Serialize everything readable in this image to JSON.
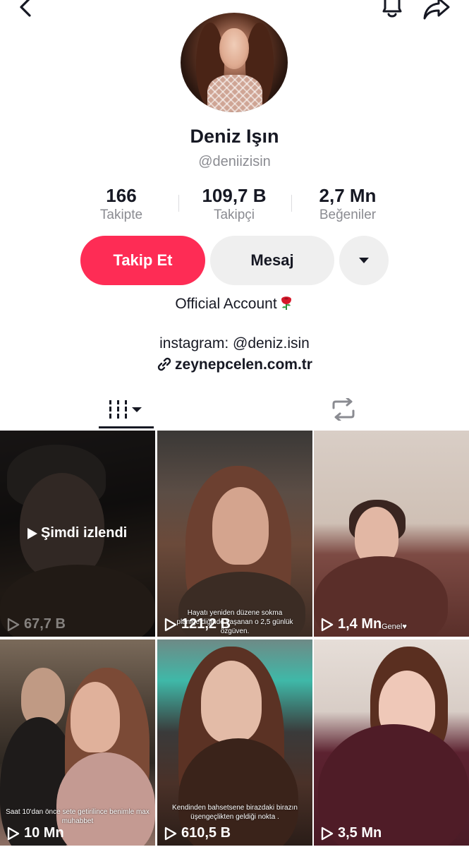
{
  "header": {
    "back_icon": "chevron-left-icon",
    "bell_icon": "bell-icon",
    "share_icon": "share-arrow-icon"
  },
  "profile": {
    "name": "Deniz Işın",
    "handle": "@deniizisin",
    "stats": [
      {
        "value": "166",
        "label": "Takipte"
      },
      {
        "value": "109,7 B",
        "label": "Takipçi"
      },
      {
        "value": "2,7 Mn",
        "label": "Beğeniler"
      }
    ],
    "follow_label": "Takip Et",
    "message_label": "Mesaj",
    "bio": "Official Account",
    "instagram": "instagram: @deniz.isin",
    "website": "zeynepcelen.com.tr"
  },
  "tabs": {
    "videos_icon": "grid-bars-icon",
    "repost_icon": "repost-icon"
  },
  "videos": [
    {
      "views": "67,7 B",
      "overlay": "Şimdi izlendi",
      "caption": ""
    },
    {
      "views": "121,2 B",
      "overlay": "",
      "caption": "Hayatı yeniden düzene sokma planıgeldiğinde yaşanan o 2,5 günlük özgüven."
    },
    {
      "views": "1,4 Mn",
      "overlay": "",
      "caption": "Genel♥"
    },
    {
      "views": "10 Mn",
      "overlay": "",
      "caption": "Saat 10'dan önce sete getirilince benimle max muhabbet"
    },
    {
      "views": "610,5 B",
      "overlay": "",
      "caption": "Kendinden bahsetsene birazdaki birazın üşengeçlikten geldiği nokta ."
    },
    {
      "views": "3,5 Mn",
      "overlay": "",
      "caption": ""
    }
  ],
  "colors": {
    "accent": "#fe2c55",
    "text_primary": "#161823",
    "text_secondary": "#8a8b91",
    "button_bg": "#efefef"
  }
}
